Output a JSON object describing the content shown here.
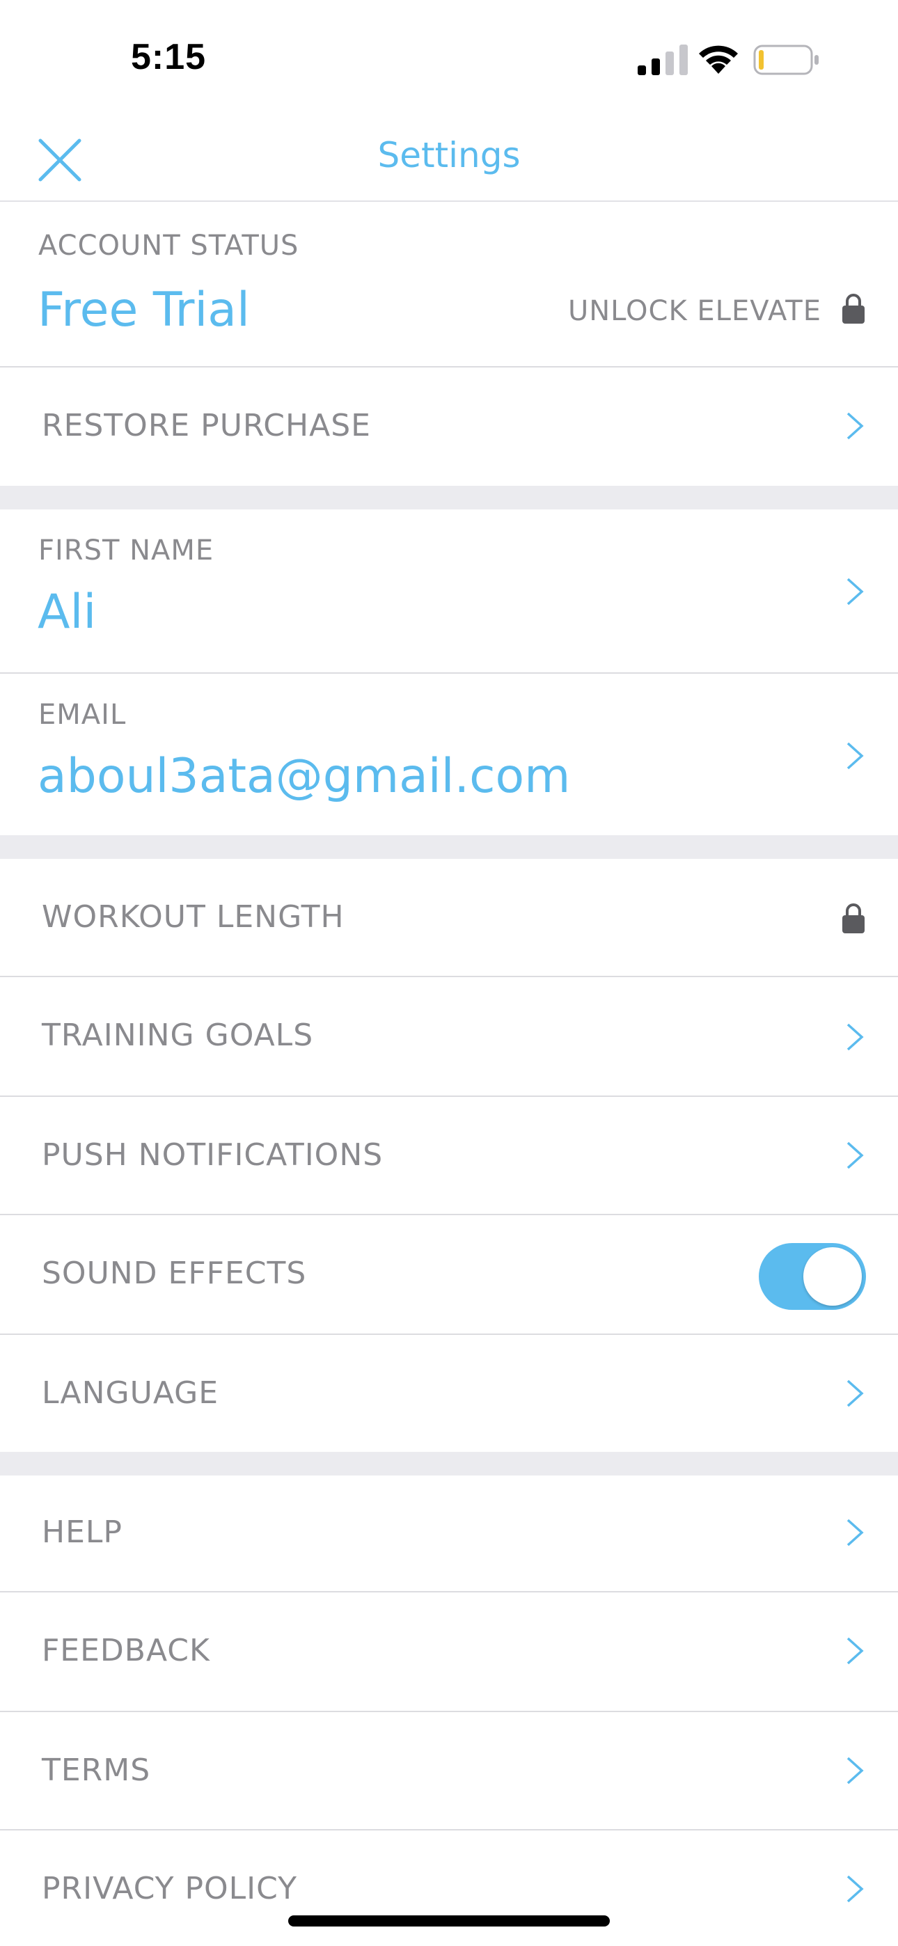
{
  "status_bar": {
    "time": "5:15",
    "icons": [
      "cellular-signal-icon",
      "wifi-icon",
      "battery-low-icon"
    ]
  },
  "nav": {
    "title": "Settings",
    "close_icon": "close-icon"
  },
  "account": {
    "label": "ACCOUNT STATUS",
    "value": "Free Trial",
    "unlock_label": "UNLOCK ELEVATE"
  },
  "restore": {
    "label": "RESTORE PURCHASE"
  },
  "first_name": {
    "label": "FIRST NAME",
    "value": "Ali"
  },
  "email": {
    "label": "EMAIL",
    "value": "aboul3ata@gmail.com"
  },
  "preferences": {
    "workout_length": "WORKOUT LENGTH",
    "training_goals": "TRAINING GOALS",
    "push_notifications": "PUSH NOTIFICATIONS",
    "sound_effects": "SOUND EFFECTS",
    "sound_effects_on": true,
    "language": "LANGUAGE"
  },
  "support": {
    "help": "HELP",
    "feedback": "FEEDBACK",
    "terms": "TERMS",
    "privacy_policy": "PRIVACY POLICY"
  },
  "colors": {
    "accent": "#5bbbee",
    "label_gray": "#8a8a8e",
    "section_gap": "#ebebef",
    "lock_gray": "#5a5a5e"
  }
}
